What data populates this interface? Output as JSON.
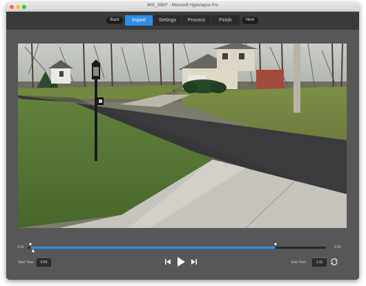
{
  "window": {
    "title": "IMG_2983* - Microsoft Hyperlapse Pro"
  },
  "toolbar": {
    "back_label": "Back",
    "next_label": "Next",
    "tabs": [
      {
        "label": "Import",
        "active": true
      },
      {
        "label": "Settings",
        "active": false
      },
      {
        "label": "Process",
        "active": false
      },
      {
        "label": "Finish",
        "active": false
      }
    ]
  },
  "timeline": {
    "current_time": "0:01",
    "total_time": "1:25",
    "trim_start_fraction": 0.01,
    "trim_end_fraction": 0.83,
    "playhead_fraction": 0.02
  },
  "controls": {
    "start_time_label": "Start Time",
    "start_time_value": "0:00",
    "end_time_label": "End Time",
    "end_time_value": "1:11",
    "icons": [
      "skip-back-icon",
      "play-icon",
      "skip-forward-icon",
      "loop-icon"
    ]
  },
  "colors": {
    "accent": "#2b8fe8",
    "window_bg": "#3d3d3d",
    "content_bg": "#575757"
  }
}
